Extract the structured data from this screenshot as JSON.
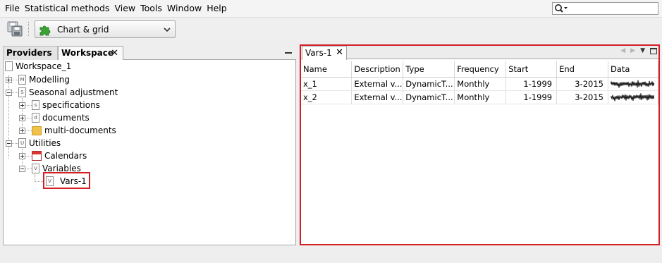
{
  "menu": [
    "File",
    "Statistical methods",
    "View",
    "Tools",
    "Window",
    "Help"
  ],
  "search": {
    "placeholder": ""
  },
  "toolbar": {
    "combo_label": "Chart & grid"
  },
  "left_tabs": {
    "providers": "Providers",
    "workspace": "Workspace"
  },
  "tree": {
    "root": "Workspace_1",
    "modelling": "Modelling",
    "seasonal": "Seasonal adjustment",
    "specifications": "specifications",
    "documents": "documents",
    "multi_documents": "multi-documents",
    "utilities": "Utilities",
    "calendars": "Calendars",
    "variables": "Variables",
    "vars1": "Vars-1"
  },
  "icon_letters": {
    "modelling": "M",
    "seasonal": "S",
    "specifications": "s",
    "documents": "d",
    "utilities": "U",
    "variables": "V",
    "vars1": "V"
  },
  "right_tab": {
    "label": "Vars-1"
  },
  "table": {
    "headers": [
      "Name",
      "Description",
      "Type",
      "Frequency",
      "Start",
      "End",
      "Data"
    ],
    "rows": [
      {
        "name": "x_1",
        "description": "External v...",
        "type": "DynamicT...",
        "frequency": "Monthly",
        "start": "1-1999",
        "end": "3-2015"
      },
      {
        "name": "x_2",
        "description": "External v...",
        "type": "DynamicT...",
        "frequency": "Monthly",
        "start": "1-1999",
        "end": "3-2015"
      }
    ]
  },
  "colors": {
    "highlight": "#d32026",
    "puzzle": "#3aa334",
    "folder": "#f0c24a"
  }
}
